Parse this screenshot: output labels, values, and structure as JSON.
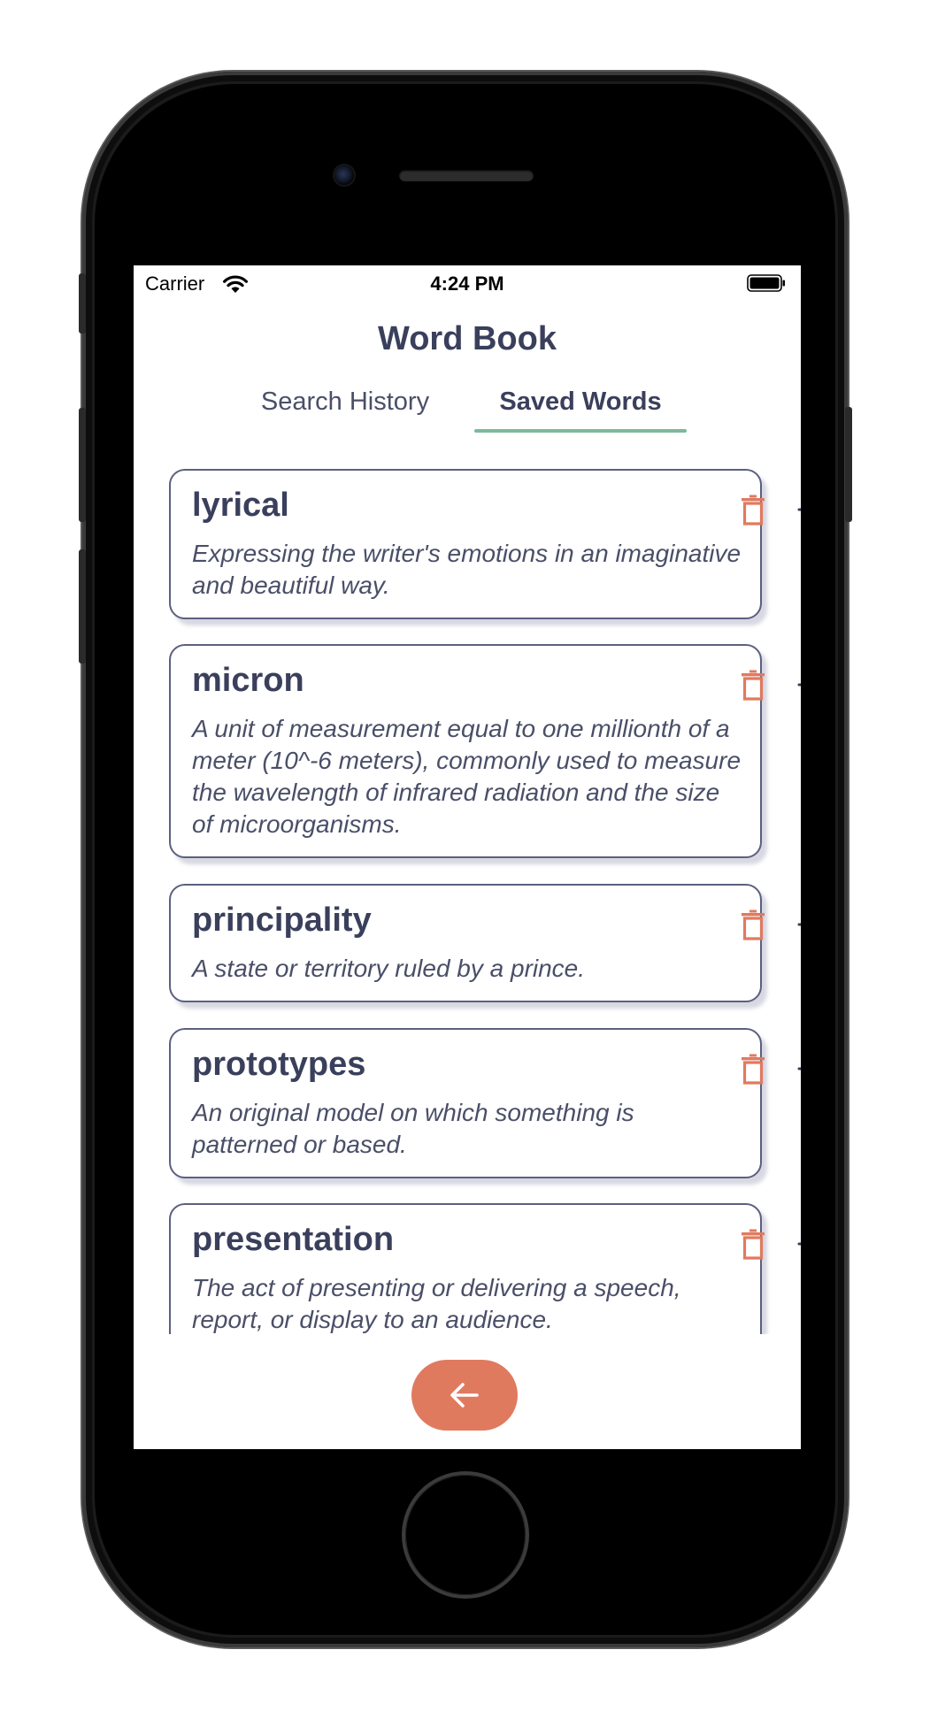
{
  "status_bar": {
    "carrier": "Carrier",
    "time": "4:24 PM"
  },
  "header": {
    "title": "Word Book"
  },
  "tabs": [
    {
      "label": "Search History",
      "active": false
    },
    {
      "label": "Saved Words",
      "active": true
    }
  ],
  "colors": {
    "accent": "#e07a5f",
    "text_dark": "#3a3f5c",
    "tab_underline": "#7db89c",
    "card_border": "#5b6080"
  },
  "icons": {
    "delete": "trash-icon",
    "add": "plus-icon",
    "pronounce": "speaker-icon",
    "back": "arrow-left-icon"
  },
  "saved_words": [
    {
      "word": "lyrical",
      "definition": "Expressing the writer's emotions in an imaginative and beautiful way."
    },
    {
      "word": "micron",
      "definition": "A unit of measurement equal to one millionth of a meter (10^-6 meters), commonly used to measure the wavelength of infrared radiation and the size of microorganisms."
    },
    {
      "word": "principality",
      "definition": "A state or territory ruled by a prince."
    },
    {
      "word": "prototypes",
      "definition": "An original model on which something is patterned or based."
    },
    {
      "word": "presentation",
      "definition": "The act of presenting or delivering a speech, report, or display to an audience."
    }
  ]
}
